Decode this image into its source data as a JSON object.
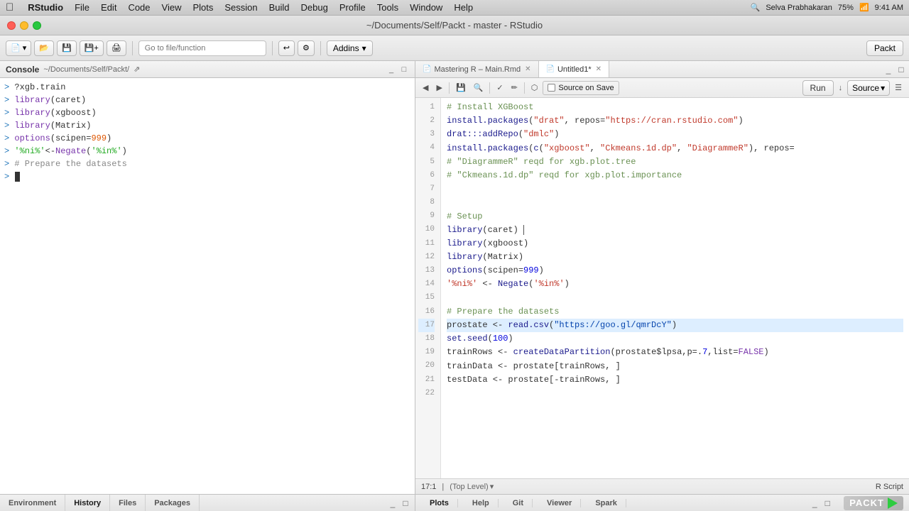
{
  "menubar": {
    "apple": "&#63743;",
    "app": "RStudio",
    "items": [
      "File",
      "Edit",
      "Code",
      "View",
      "Plots",
      "Session",
      "Build",
      "Debug",
      "Profile",
      "Tools",
      "Window",
      "Help"
    ],
    "right_icons": [
      "search",
      "settings"
    ],
    "user": "Selva Prabhakaran",
    "battery": "75%",
    "wifi": "wifi"
  },
  "titlebar": {
    "title": "~/Documents/Self/Packt - master - RStudio"
  },
  "toolbar": {
    "go_to_file_placeholder": "Go to file/function",
    "addins_label": "Addins",
    "packt_label": "Packt"
  },
  "left_panel": {
    "tab_label": "Console",
    "path": "~/Documents/Self/Packt/",
    "console_lines": [
      {
        "prompt": ">",
        "content": "?xgb.train",
        "type": "default"
      },
      {
        "prompt": ">",
        "content": "library(caret)",
        "type": "func"
      },
      {
        "prompt": ">",
        "content": "library(xgboost)",
        "type": "func"
      },
      {
        "prompt": ">",
        "content": "library(Matrix)",
        "type": "func"
      },
      {
        "prompt": ">",
        "content": "options(scipen=999)",
        "type": "default"
      },
      {
        "prompt": ">",
        "content": "'%ni%' <- Negate('%in%')",
        "type": "default"
      },
      {
        "prompt": ">",
        "content": "# Prepare the datasets",
        "type": "comment"
      },
      {
        "prompt": ">",
        "content": "",
        "type": "cursor"
      }
    ]
  },
  "editor": {
    "tabs": [
      {
        "label": "Mastering R - Main.Rmd",
        "icon": "📄",
        "active": false,
        "closeable": true
      },
      {
        "label": "Untitled1*",
        "icon": "📄",
        "active": true,
        "closeable": true
      }
    ],
    "source_on_save": "Source on Save",
    "run_label": "Run",
    "source_label": "Source",
    "lines": [
      {
        "num": 1,
        "tokens": [
          {
            "t": "comment",
            "v": "# Install XGBoost"
          }
        ]
      },
      {
        "num": 2,
        "tokens": [
          {
            "t": "func",
            "v": "install.packages"
          },
          {
            "t": "default",
            "v": "("
          },
          {
            "t": "string",
            "v": "\"drat\""
          },
          {
            "t": "default",
            "v": ", repos="
          },
          {
            "t": "string",
            "v": "\"https://cran.rstudio.com\""
          }
        ],
        "suffix": ")"
      },
      {
        "num": 3,
        "tokens": [
          {
            "t": "func",
            "v": "drat:::addRepo"
          },
          {
            "t": "default",
            "v": "("
          },
          {
            "t": "string",
            "v": "\"dmlc\""
          },
          {
            "t": "default",
            "v": ")"
          }
        ]
      },
      {
        "num": 4,
        "tokens": [
          {
            "t": "func",
            "v": "install.packages"
          },
          {
            "t": "default",
            "v": "("
          },
          {
            "t": "func",
            "v": "c"
          },
          {
            "t": "default",
            "v": "("
          },
          {
            "t": "string",
            "v": "\"xgboost\""
          },
          {
            "t": "default",
            "v": ", "
          },
          {
            "t": "string",
            "v": "\"Ckmeans.1d.dp\""
          },
          {
            "t": "default",
            "v": ", "
          },
          {
            "t": "string",
            "v": "\"DiagrammeR\""
          },
          {
            "t": "default",
            "v": "), repos="
          }
        ]
      },
      {
        "num": 5,
        "tokens": [
          {
            "t": "comment",
            "v": "# \"DiagrammeR\" reqd for xgb.plot.tree"
          }
        ]
      },
      {
        "num": 6,
        "tokens": [
          {
            "t": "comment",
            "v": "# \"Ckmeans.1d.dp\" reqd for xgb.plot.importance"
          }
        ]
      },
      {
        "num": 7,
        "tokens": []
      },
      {
        "num": 8,
        "tokens": []
      },
      {
        "num": 9,
        "tokens": [
          {
            "t": "comment",
            "v": "# Setup"
          }
        ]
      },
      {
        "num": 10,
        "tokens": [
          {
            "t": "func",
            "v": "library"
          },
          {
            "t": "default",
            "v": "(caret) "
          }
        ],
        "cursor": true
      },
      {
        "num": 11,
        "tokens": [
          {
            "t": "func",
            "v": "library"
          },
          {
            "t": "default",
            "v": "(xgboost)"
          }
        ]
      },
      {
        "num": 12,
        "tokens": [
          {
            "t": "func",
            "v": "library"
          },
          {
            "t": "default",
            "v": "(Matrix)"
          }
        ]
      },
      {
        "num": 13,
        "tokens": [
          {
            "t": "func",
            "v": "options"
          },
          {
            "t": "default",
            "v": "(scipen="
          },
          {
            "t": "number",
            "v": "999"
          },
          {
            "t": "default",
            "v": ")"
          }
        ]
      },
      {
        "num": 14,
        "tokens": [
          {
            "t": "string",
            "v": "'%ni%'"
          },
          {
            "t": "default",
            "v": " <- "
          },
          {
            "t": "func",
            "v": "Negate"
          },
          {
            "t": "default",
            "v": "("
          },
          {
            "t": "string",
            "v": "'%in%'"
          },
          {
            "t": "default",
            "v": ")"
          }
        ]
      },
      {
        "num": 15,
        "tokens": []
      },
      {
        "num": 16,
        "tokens": [
          {
            "t": "comment",
            "v": "# Prepare the datasets"
          }
        ]
      },
      {
        "num": 17,
        "tokens": [
          {
            "t": "default",
            "v": "prostate <- "
          },
          {
            "t": "func",
            "v": "read.csv"
          },
          {
            "t": "default",
            "v": "("
          },
          {
            "t": "string",
            "v": "\"https://goo.gl/qmrDcY\""
          },
          {
            "t": "default",
            "v": ")"
          }
        ],
        "highlighted": true
      },
      {
        "num": 18,
        "tokens": [
          {
            "t": "func",
            "v": "set.seed"
          },
          {
            "t": "default",
            "v": "("
          },
          {
            "t": "number",
            "v": "100"
          },
          {
            "t": "default",
            "v": ")"
          }
        ]
      },
      {
        "num": 19,
        "tokens": [
          {
            "t": "default",
            "v": "trainRows <- "
          },
          {
            "t": "func",
            "v": "createDataPartition"
          },
          {
            "t": "default",
            "v": "(prostate$lpsa,p=."
          },
          {
            "t": "number",
            "v": "7"
          },
          {
            "t": "default",
            "v": ",list="
          },
          {
            "t": "keyword",
            "v": "FALSE"
          },
          {
            "t": "default",
            "v": ")"
          }
        ]
      },
      {
        "num": 20,
        "tokens": [
          {
            "t": "default",
            "v": "trainData <- prostate[trainRows, ]"
          }
        ]
      },
      {
        "num": 21,
        "tokens": [
          {
            "t": "default",
            "v": "testData <- prostate[-trainRows, ]"
          }
        ]
      },
      {
        "num": 22,
        "tokens": []
      }
    ],
    "status": {
      "position": "17:1",
      "level": "(Top Level)",
      "r_script": "R Script"
    }
  },
  "bottom_left_tabs": [
    {
      "label": "Environment",
      "active": false
    },
    {
      "label": "History",
      "active": false
    },
    {
      "label": "Files",
      "active": false
    },
    {
      "label": "Packages",
      "active": false
    }
  ],
  "bottom_right_tabs": [
    {
      "label": "Plots",
      "active": false
    },
    {
      "label": "Help",
      "active": false
    },
    {
      "label": "Git",
      "active": false
    },
    {
      "label": "Viewer",
      "active": false
    },
    {
      "label": "Spark",
      "active": false
    }
  ]
}
